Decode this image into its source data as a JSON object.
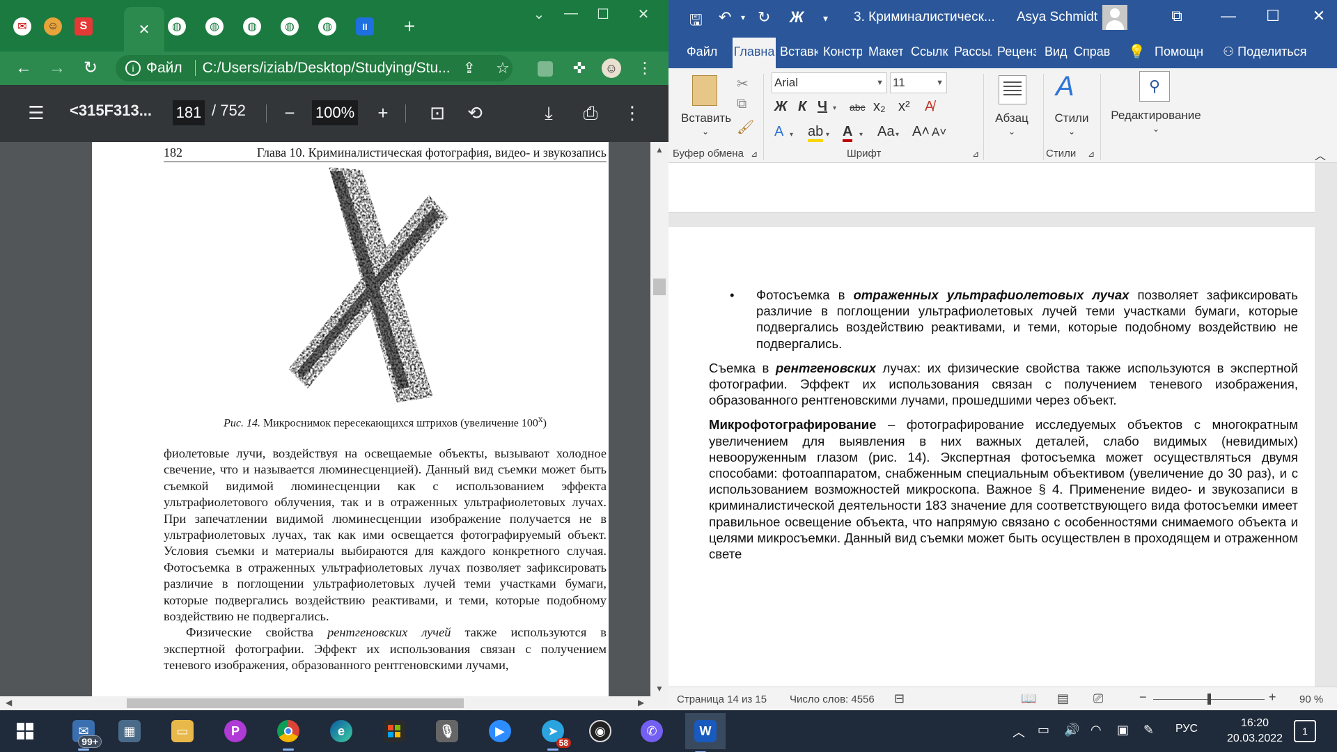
{
  "chrome": {
    "tabs": [
      {
        "icon": "yandex-mail-icon",
        "glyph": "✉"
      },
      {
        "icon": "profile-avatar-icon",
        "glyph": "☺"
      },
      {
        "icon": "s-app-icon",
        "glyph": "S"
      },
      {
        "icon": "close-tab-icon",
        "glyph": "✕"
      },
      {
        "icon": "globe-icon",
        "glyph": "◍"
      },
      {
        "icon": "globe-icon",
        "glyph": "◍"
      },
      {
        "icon": "globe-icon",
        "glyph": "◍"
      },
      {
        "icon": "globe-icon",
        "glyph": "◍"
      },
      {
        "icon": "globe-icon",
        "glyph": "◍"
      },
      {
        "icon": "pause-app-icon",
        "glyph": "II"
      }
    ],
    "new_tab_glyph": "+",
    "url_scheme": "Файл",
    "url": "C:/Users/iziab/Desktop/Studying/Stu...",
    "pdf": {
      "title": "<315F313...",
      "page_current": "181",
      "page_total": "/ 752",
      "zoom": "100%",
      "running_page_number": "182",
      "running_chapter": "Глава 10. Криминалистическая фотография, видео- и звукозапись",
      "caption_label": "Рис. 14.",
      "caption_text": "Микроснимок пересекающихся штрихов (увеличение 100",
      "caption_sup": "x",
      "caption_end": ")",
      "paragraph_1": "фиолетовые лучи, воздействуя на освещаемые объекты, вызывают холодное свечение, что и называется люминесценцией). Данный вид съемки может быть съемкой видимой люминесценции как с использованием эффекта ультрафиолетового облучения, так и в отраженных ультрафиолетовых лучах. При запечатлении видимой люминесценции изображение получается не в ультрафиолетовых лучах, так как ими освещается фотографируемый объект. Условия съемки и материалы выбираются для каждого конкретного случая. Фотосъемка в отраженных ультрафиолетовых лучах позволяет зафиксировать различие в поглощении ультрафиолетовых лучей теми участками бумаги, которые подвергались воздействию реактивами, и теми, которые подобному воздействию не подвергались.",
      "paragraph_2_start": "Физические свойства ",
      "paragraph_2_italic": "рентгеновских лучей",
      "paragraph_2_rest": " также используются в экспертной фотографии. Эффект их использования связан с получением теневого изображения, образованного рентгеновскими лучами,"
    }
  },
  "word": {
    "doc_title": "3. Криминалистическ...",
    "user_name": "Asya Schmidt",
    "menu_tabs": [
      "Файл",
      "Главна",
      "Вставк",
      "Констр",
      "Макет",
      "Ссылкі",
      "Рассыл",
      "Реценз",
      "Вид",
      "Справ"
    ],
    "help_label": "Помощн",
    "share_label": "Поделиться",
    "ribbon": {
      "paste_label": "Вставить",
      "clipboard_group": "Буфер обмена",
      "font_name": "Arial",
      "font_size": "11",
      "font_group": "Шрифт",
      "bold": "Ж",
      "italic": "К",
      "underline": "Ч",
      "strike": "abc",
      "subscript": "x₂",
      "superscript": "x²",
      "case_label": "Aa",
      "grow_font": "A˄",
      "shrink_font": "A˅",
      "paragraph_label": "Абзац",
      "styles_label": "Стили",
      "styles_group": "Стили",
      "editing_label": "Редактирование"
    },
    "document": {
      "bullet_start": "Фотосъемка в ",
      "bullet_bold_italic": "отраженных ультрафиолетовых лучах",
      "bullet_rest": " позволяет зафиксировать различие в поглощении ультрафиолетовых лучей теми участками бумаги, которые подвергались воздействию реактивами, и теми, которые подобному воздействию не подвергались.",
      "p2_start": "Съемка в ",
      "p2_bold_italic": "рентгеновских",
      "p2_rest": " лучах: их физические свойства также используются в экспертной фотографии. Эффект их использования связан с получением теневого изображения, образованного рентгеновскими лучами, прошедшими через объект.",
      "p3_bold": "Микрофотографирование",
      "p3_rest": " – фотографирование исследуемых объектов с многократным увеличением для выявления в них важных деталей, слабо видимых (невидимых) невооруженным глазом (рис. 14). Экспертная фотосъемка может осуществляться двумя способами: фотоаппаратом, снабженным специальным объективом (увеличение до 30 раз), и с использованием возможностей микроскопа. Важное § 4. Применение видео- и звукозаписи в криминалистической деятельности 183 значение для соответствующего вида фотосъемки имеет правильное освещение объекта, что напрямую связано с особенностями снимаемого объекта и целями микросъемки. Данный вид съемки может быть осуществлен в проходящем и отраженном свете"
    },
    "status": {
      "page": "Страница 14 из 15",
      "words": "Число слов: 4556",
      "zoom": "90 %",
      "zoom_fraction": 0.5
    }
  },
  "taskbar": {
    "mail_badge": "99+",
    "telegram_badge": "58",
    "language": "РУС",
    "time": "16:20",
    "date": "20.03.2022",
    "notifications": "1"
  },
  "colors": {
    "chrome_green": "#1a7a3f",
    "word_blue": "#2b579a",
    "pdf_toolbar": "#323639"
  }
}
